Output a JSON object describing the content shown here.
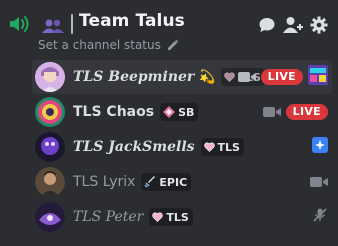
{
  "channel": {
    "title": "Team Talus",
    "status_placeholder": "Set a channel status"
  },
  "users": [
    {
      "name": "TLS Beepminer",
      "emoji": "💫",
      "tag": "TLS",
      "tag_truncated": true,
      "badge": "LIVE",
      "has_camera": true,
      "extra_icon": "game-thumbnail-icon"
    },
    {
      "name": "TLS Chaos",
      "tag": "SB",
      "badge": "LIVE",
      "has_camera": true
    },
    {
      "name": "TLS JackSmells",
      "tag": "TLS",
      "status_icon": "activity-icon"
    },
    {
      "name": "TLS Lyrix",
      "tag": "EPIC",
      "has_camera": true
    },
    {
      "name": "TLS Peter",
      "tag": "TLS",
      "status_icon": "muted-mic-icon"
    }
  ],
  "colors": {
    "background": "#2b2d31",
    "live_badge": "#da373c",
    "voice_green": "#23a55a",
    "activity_blue": "#3b82f6"
  }
}
